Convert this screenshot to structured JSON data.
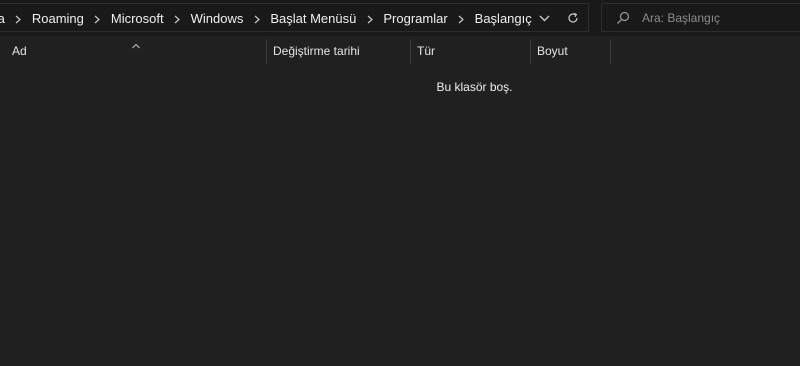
{
  "breadcrumb": {
    "items": [
      "ta",
      "Roaming",
      "Microsoft",
      "Windows",
      "Başlat Menüsü",
      "Programlar",
      "Başlangıç"
    ]
  },
  "search": {
    "placeholder": "Ara: Başlangıç"
  },
  "columns": {
    "name": "Ad",
    "modified": "Değiştirme tarihi",
    "type": "Tür",
    "size": "Boyut"
  },
  "content": {
    "empty_message": "Bu klasör boş."
  },
  "icons": {
    "separator": "chevron-right-icon",
    "dropdown": "chevron-down-icon",
    "refresh": "refresh-icon",
    "search": "search-icon",
    "sort": "sort-up-icon"
  },
  "colors": {
    "background": "#202020",
    "toolbar": "#191919",
    "border": "#2d2d2d",
    "text": "#f0f0f0"
  }
}
